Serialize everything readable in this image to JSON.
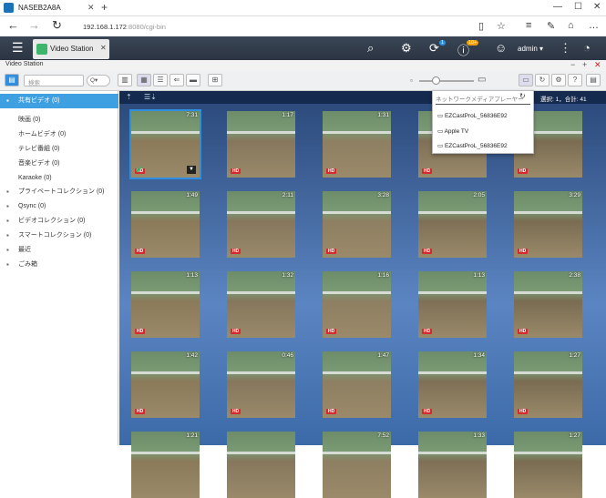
{
  "browser": {
    "tab_title": "NASEB2A8A",
    "url_host": "192.168.1.172",
    "url_rest": ":8080/cgi-bin"
  },
  "app": {
    "tab_label": "Video Station",
    "user": "admin",
    "badge_update": "1",
    "badge_info": "10+"
  },
  "window": {
    "title": "Video Station"
  },
  "toolbar": {
    "search_placeholder": "検索",
    "filter_label": "Q▾"
  },
  "sidebar": {
    "items": [
      {
        "label": "共有ビデオ (0)",
        "selected": true,
        "indent": 0,
        "icon": "share-icon"
      },
      {
        "label": "映画 (0)",
        "indent": 1
      },
      {
        "label": "ホームビデオ (0)",
        "indent": 1
      },
      {
        "label": "テレビ番組 (0)",
        "indent": 1
      },
      {
        "label": "音楽ビデオ (0)",
        "indent": 1
      },
      {
        "label": "Karaoke (0)",
        "indent": 1
      },
      {
        "label": "プライベートコレクション (0)",
        "indent": 0,
        "icon": "lock-icon"
      },
      {
        "label": "Qsync (0)",
        "indent": 0,
        "icon": "sync-icon"
      },
      {
        "label": "ビデオコレクション (0)",
        "indent": 0,
        "icon": "collection-icon"
      },
      {
        "label": "スマートコレクション (0)",
        "indent": 0,
        "icon": "smart-icon"
      },
      {
        "label": "最近",
        "indent": 0,
        "icon": "clock-icon"
      },
      {
        "label": "ごみ箱",
        "indent": 0,
        "icon": "trash-icon"
      }
    ]
  },
  "main": {
    "selection_info": "選択: 1，合計: 41"
  },
  "dropdown": {
    "header": "ネットワークメディアプレーヤー",
    "items": [
      "EZCastProL_56836E92",
      "Apple TV",
      "EZCastProL_56836E92"
    ]
  },
  "thumbs": [
    {
      "dur": "7:31",
      "hd": "HD",
      "sel": true
    },
    {
      "dur": "1:17",
      "hd": "HD"
    },
    {
      "dur": "1:31",
      "hd": "HD"
    },
    {
      "dur": "",
      "hd": "HD"
    },
    {
      "dur": "",
      "hd": "HD"
    },
    {
      "dur": "1:49",
      "hd": "HD"
    },
    {
      "dur": "2:11",
      "hd": "HD"
    },
    {
      "dur": "3:28",
      "hd": "HD"
    },
    {
      "dur": "2:05",
      "hd": "HD"
    },
    {
      "dur": "3:29",
      "hd": "HD"
    },
    {
      "dur": "1:13",
      "hd": "HD"
    },
    {
      "dur": "1:32",
      "hd": "HD"
    },
    {
      "dur": "1:16",
      "hd": "HD"
    },
    {
      "dur": "1:13",
      "hd": "HD"
    },
    {
      "dur": "2:38",
      "hd": "HD"
    },
    {
      "dur": "1:42",
      "hd": "HD"
    },
    {
      "dur": "0:46",
      "hd": "HD"
    },
    {
      "dur": "1:47",
      "hd": "HD"
    },
    {
      "dur": "1:34",
      "hd": "HD"
    },
    {
      "dur": "1:27",
      "hd": "HD"
    },
    {
      "dur": "1:21",
      "hd": ""
    },
    {
      "dur": "",
      "hd": ""
    },
    {
      "dur": "7:52",
      "hd": ""
    },
    {
      "dur": "1:33",
      "hd": ""
    },
    {
      "dur": "1:27",
      "hd": ""
    }
  ]
}
